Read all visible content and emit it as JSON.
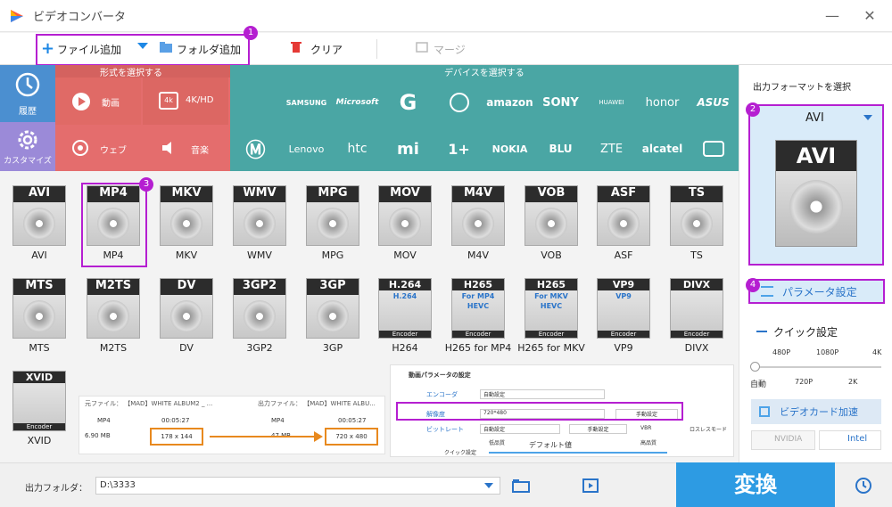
{
  "app": {
    "title": "ビデオコンバータ"
  },
  "toolbar": {
    "add_file": "ファイル追加",
    "add_folder": "フォルダ追加",
    "clear": "クリア",
    "merge": "マージ"
  },
  "badges": [
    "1",
    "2",
    "3",
    "4"
  ],
  "nav": {
    "history": "履歴",
    "customize": "カスタマイズ"
  },
  "sections": {
    "format_select": "形式を選択する",
    "device_select": "デバイスを選択する"
  },
  "categories": {
    "video": "動画",
    "hd": "4K/HD",
    "web": "ウェブ",
    "music": "音楽"
  },
  "brands": [
    "SAMSUNG",
    "Microsoft",
    "amazon",
    "SONY",
    "HUAWEI",
    "honor",
    "ASUS",
    "Lenovo",
    "htc",
    "NOKIA",
    "BLU",
    "ZTE",
    "alcatel"
  ],
  "formats_row1": [
    "AVI",
    "MP4",
    "MKV",
    "WMV",
    "MPG",
    "MOV",
    "M4V",
    "VOB",
    "ASF",
    "TS"
  ],
  "formats_row2": [
    "MTS",
    "M2TS",
    "DV",
    "3GP2",
    "3GP",
    "H264",
    "H265 for MP4",
    "H265 for MKV",
    "VP9",
    "DIVX"
  ],
  "formats_row3": [
    "XVID"
  ],
  "format_icons": {
    "H264": [
      "H.264",
      "H.264",
      "Encoder"
    ],
    "H265 for MP4": [
      "H265",
      "For MP4",
      "HEVC",
      "Encoder"
    ],
    "H265 for MKV": [
      "H265",
      "For MKV",
      "HEVC",
      "Encoder"
    ],
    "VP9": [
      "VP9",
      "VP9",
      "Encoder"
    ],
    "DIVX": [
      "DIVX",
      "Encoder"
    ],
    "XVID": [
      "XVID",
      "Encoder"
    ]
  },
  "preview": {
    "src_label": "元ファイル： 【MAD】WHITE ALBUM2 _ ...",
    "src_format": "MP4",
    "src_duration": "00:05:27",
    "src_size": "6.90 MB",
    "src_res": "178 x 144",
    "dst_label": "出力ファイル： 【MAD】WHITE ALBU...",
    "dst_format": "MP4",
    "dst_duration": "00:05:27",
    "dst_size": "47 MB",
    "dst_res": "720 x 480",
    "param_title": "動画パラメータの設定",
    "encoder_label": "エンコーダ",
    "encoder_value": "自動設定",
    "res_label": "解像度",
    "res_value": "720*480",
    "bitrate_label": "ビットレート",
    "bitrate_value": "自動設定",
    "manual1": "手動設定",
    "manual2": "手動設定",
    "vbr": "VBR",
    "lossless": "ロスレスモード",
    "quick_label": "クイック設定",
    "low": "低品質",
    "default": "デフォルト値",
    "high": "高品質"
  },
  "right": {
    "output_title": "出力フォーマットを選択",
    "selected_format": "AVI",
    "param_button": "パラメータ設定",
    "quick_title": "クイック設定",
    "res_top": [
      "480P",
      "1080P",
      "4K"
    ],
    "res_bottom": [
      "自動",
      "720P",
      "2K"
    ],
    "gpu_title": "ビデオカード加速",
    "nvidia": "NVIDIA",
    "intel": "Intel"
  },
  "bottom": {
    "folder_label": "出力フォルダ：",
    "folder_path": "D:\\3333",
    "convert": "変換"
  },
  "colors": {
    "highlight": "#b51fd1",
    "teal": "#4aa6a4",
    "nav_blue": "#4b8fd0",
    "nav_purple": "#9b8ad8",
    "cat_red": "#e46d6d",
    "convert": "#2d9be3"
  }
}
